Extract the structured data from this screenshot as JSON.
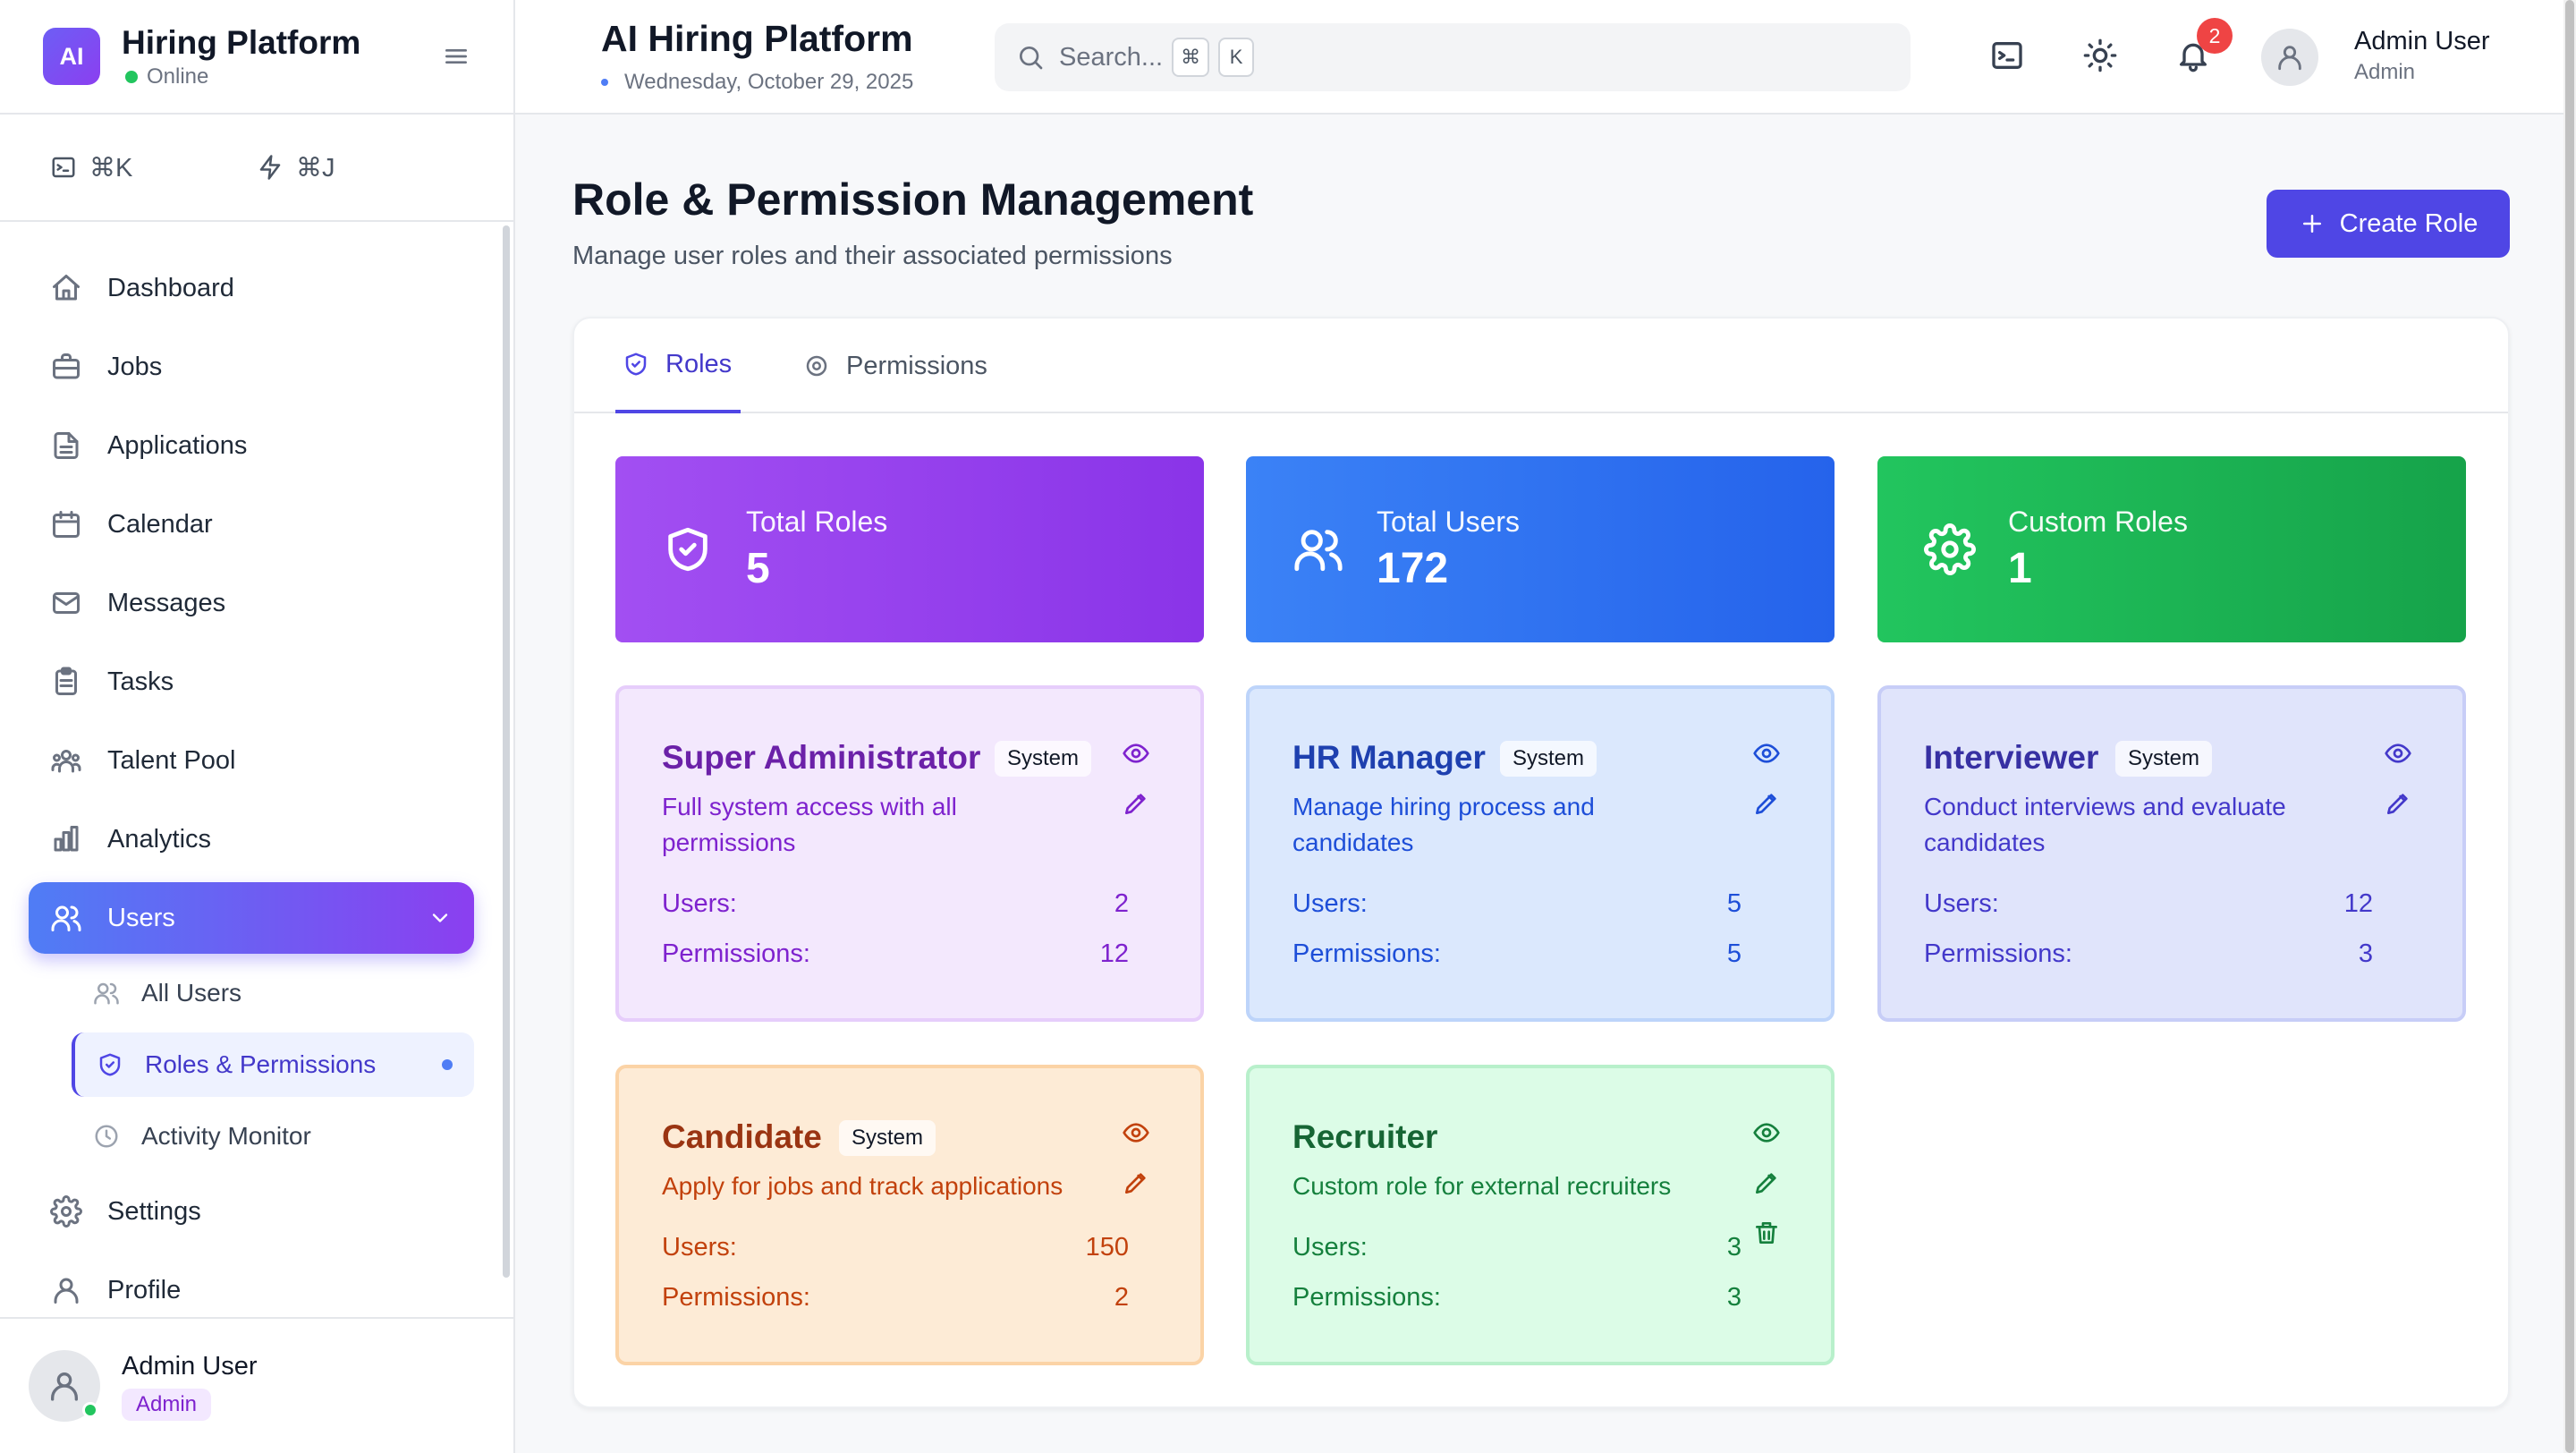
{
  "brand": {
    "logo": "AI",
    "name": "Hiring Platform",
    "status": "Online"
  },
  "shortcuts": [
    {
      "icon": "terminal-icon",
      "keys": "⌘K"
    },
    {
      "icon": "lightning-icon",
      "keys": "⌘J"
    }
  ],
  "nav": {
    "dashboard": "Dashboard",
    "jobs": "Jobs",
    "applications": "Applications",
    "calendar": "Calendar",
    "messages": "Messages",
    "tasks": "Tasks",
    "talent_pool": "Talent Pool",
    "analytics": "Analytics",
    "users": "Users",
    "users_sub": {
      "all_users": "All Users",
      "roles_permissions": "Roles & Permissions",
      "activity_monitor": "Activity Monitor"
    },
    "settings": "Settings",
    "profile": "Profile"
  },
  "sidebar_user": {
    "name": "Admin User",
    "role": "Admin"
  },
  "header": {
    "title": "AI Hiring Platform",
    "date": "Wednesday, October 29, 2025",
    "search_placeholder": "Search...",
    "search_keys": [
      "⌘",
      "K"
    ],
    "notification_count": "2",
    "user_name": "Admin User",
    "user_role": "Admin"
  },
  "page": {
    "title": "Role & Permission Management",
    "subtitle": "Manage user roles and their associated permissions",
    "create_button": "Create Role"
  },
  "tabs": [
    {
      "label": "Roles",
      "active": true
    },
    {
      "label": "Permissions",
      "active": false
    }
  ],
  "stats": [
    {
      "label": "Total Roles",
      "value": "5",
      "color": "#9333ea"
    },
    {
      "label": "Total Users",
      "value": "172",
      "color": "#2563eb"
    },
    {
      "label": "Custom Roles",
      "value": "1",
      "color": "#16a34a"
    }
  ],
  "labels": {
    "users": "Users:",
    "permissions": "Permissions:",
    "system": "System"
  },
  "roles": [
    {
      "name": "Super Administrator",
      "description": "Full system access with all permissions",
      "users": "2",
      "permissions": "12",
      "system": true,
      "color": "#7e22ce"
    },
    {
      "name": "HR Manager",
      "description": "Manage hiring process and candidates",
      "users": "5",
      "permissions": "5",
      "system": true,
      "color": "#1d4ed8"
    },
    {
      "name": "Interviewer",
      "description": "Conduct interviews and evaluate candidates",
      "users": "12",
      "permissions": "3",
      "system": true,
      "color": "#4338ca"
    },
    {
      "name": "Candidate",
      "description": "Apply for jobs and track applications",
      "users": "150",
      "permissions": "2",
      "system": true,
      "color": "#c2410c"
    },
    {
      "name": "Recruiter",
      "description": "Custom role for external recruiters",
      "users": "3",
      "permissions": "3",
      "system": false,
      "color": "#15803d"
    }
  ]
}
